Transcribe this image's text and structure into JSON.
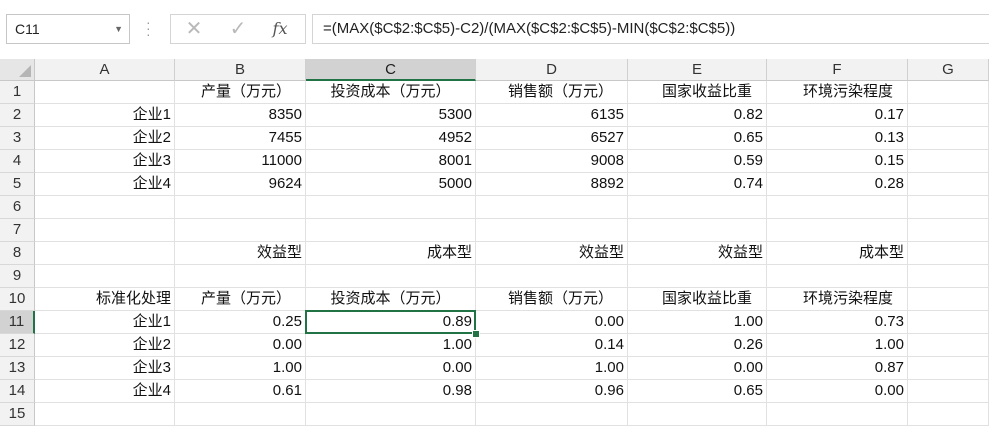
{
  "formula_bar": {
    "name_box": "C11",
    "formula": "=(MAX($C$2:$C$5)-C2)/(MAX($C$2:$C$5)-MIN($C$2:$C$5))"
  },
  "columns": [
    "A",
    "B",
    "C",
    "D",
    "E",
    "F",
    "G"
  ],
  "rows": [
    "1",
    "2",
    "3",
    "4",
    "5",
    "6",
    "7",
    "8",
    "9",
    "10",
    "11",
    "12",
    "13",
    "14",
    "15"
  ],
  "cells": {
    "r1": [
      "",
      "产量（万元）",
      "投资成本（万元）",
      "销售额（万元）",
      "国家收益比重",
      "环境污染程度",
      ""
    ],
    "r2": [
      "企业1",
      "8350",
      "5300",
      "6135",
      "0.82",
      "0.17",
      ""
    ],
    "r3": [
      "企业2",
      "7455",
      "4952",
      "6527",
      "0.65",
      "0.13",
      ""
    ],
    "r4": [
      "企业3",
      "11000",
      "8001",
      "9008",
      "0.59",
      "0.15",
      ""
    ],
    "r5": [
      "企业4",
      "9624",
      "5000",
      "8892",
      "0.74",
      "0.28",
      ""
    ],
    "r6": [
      "",
      "",
      "",
      "",
      "",
      "",
      ""
    ],
    "r7": [
      "",
      "",
      "",
      "",
      "",
      "",
      ""
    ],
    "r8": [
      "",
      "效益型",
      "成本型",
      "效益型",
      "效益型",
      "成本型",
      ""
    ],
    "r9": [
      "",
      "",
      "",
      "",
      "",
      "",
      ""
    ],
    "r10": [
      "标准化处理",
      "产量（万元）",
      "投资成本（万元）",
      "销售额（万元）",
      "国家收益比重",
      "环境污染程度",
      ""
    ],
    "r11": [
      "企业1",
      "0.25",
      "0.89",
      "0.00",
      "1.00",
      "0.73",
      ""
    ],
    "r12": [
      "企业2",
      "0.00",
      "1.00",
      "0.14",
      "0.26",
      "1.00",
      ""
    ],
    "r13": [
      "企业3",
      "1.00",
      "0.00",
      "1.00",
      "0.00",
      "0.87",
      ""
    ],
    "r14": [
      "企业4",
      "0.61",
      "0.98",
      "0.96",
      "0.65",
      "0.00",
      ""
    ],
    "r15": [
      "",
      "",
      "",
      "",
      "",
      "",
      ""
    ]
  },
  "selected_cell": "C11",
  "accent_color": "#217346"
}
